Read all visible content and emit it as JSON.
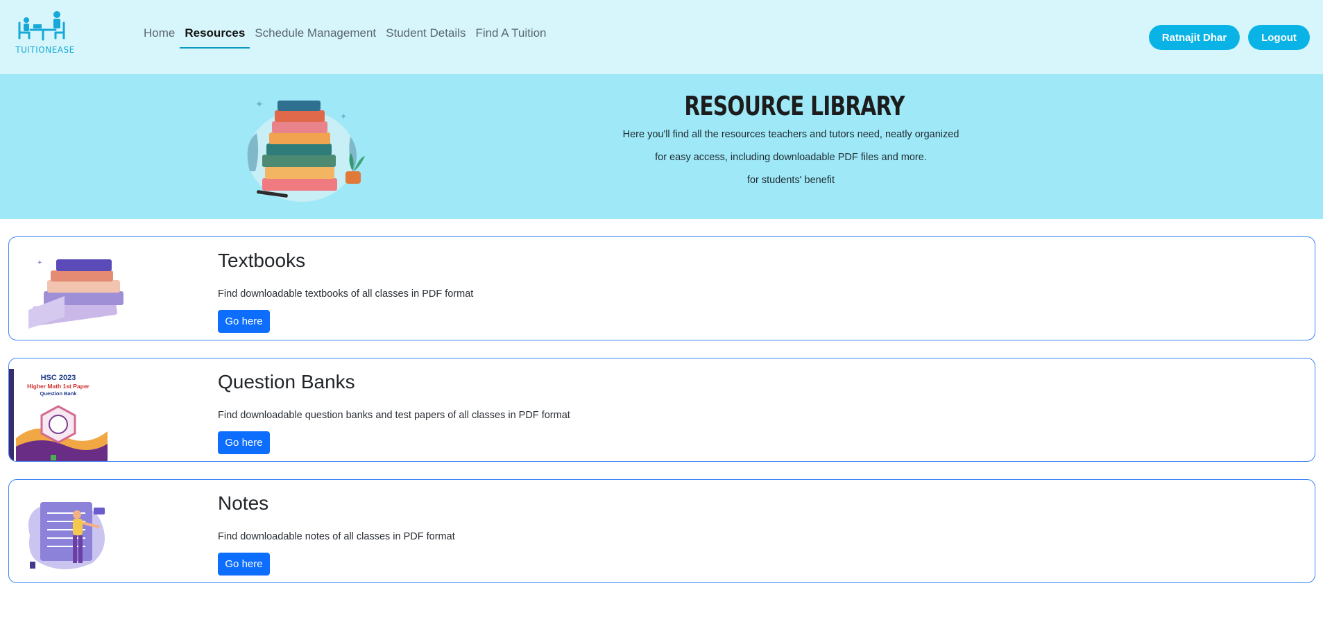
{
  "navbar": {
    "logo_text": "TUITIONEASE",
    "links": [
      "Home",
      "Resources",
      "Schedule Management",
      "Student Details",
      "Find A Tuition"
    ],
    "active_link": "Resources",
    "user_button": "Ratnajit Dhar",
    "logout_button": "Logout"
  },
  "hero": {
    "title": "RESOURCE LIBRARY",
    "line1": "Here you'll find all the resources teachers and tutors need, neatly organized",
    "line2": "for easy access, including downloadable PDF files and more.",
    "line3": "for students' benefit"
  },
  "cards": [
    {
      "title": "Textbooks",
      "text": "Find downloadable textbooks of all classes in PDF format",
      "button": "Go here"
    },
    {
      "title": "Question Banks",
      "text": "Find downloadable question banks and test papers of all classes in PDF format",
      "button": "Go here",
      "image_text": {
        "l1": "HSC 2023",
        "l2": "Higher Math 1st Paper",
        "l3": "Question Bank"
      }
    },
    {
      "title": "Notes",
      "text": "Find downloadable notes of all classes in PDF format",
      "button": "Go here"
    }
  ],
  "colors": {
    "nav_bg": "#d6f6fb",
    "hero_bg": "#9ee8f7",
    "accent": "#0ab3e6",
    "primary": "#0d6efd"
  }
}
